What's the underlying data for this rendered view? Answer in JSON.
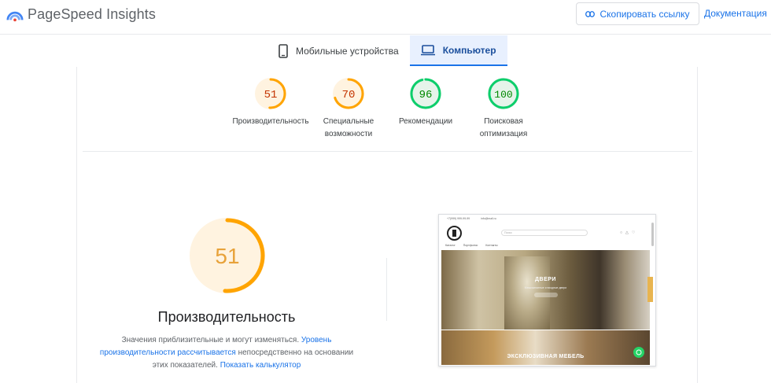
{
  "header": {
    "logo_text": "PageSpeed Insights",
    "copy_link_label": "Скопировать ссылку",
    "docs_label": "Документация"
  },
  "tabs": [
    {
      "label": "Мобильные устройства",
      "active": false,
      "icon": "phone-icon"
    },
    {
      "label": "Компьютер",
      "active": true,
      "icon": "laptop-icon"
    }
  ],
  "scores": [
    {
      "value": 51,
      "label_line1": "Производительность",
      "label_line2": "",
      "status": "average"
    },
    {
      "value": 70,
      "label_line1": "Специальные",
      "label_line2": "возможности",
      "status": "average"
    },
    {
      "value": 96,
      "label_line1": "Рекомендации",
      "label_line2": "",
      "status": "good"
    },
    {
      "value": 100,
      "label_line1": "Поисковая",
      "label_line2": "оптимизация",
      "status": "good"
    }
  ],
  "main_score": {
    "value": 51,
    "title": "Производительность",
    "note_prefix": "Значения приблизительные и могут изменяться. ",
    "note_link1": "Уровень производительности рассчитывается",
    "note_middle": " непосредственно на основании этих показателей. ",
    "note_link2": "Показать калькулятор"
  },
  "thumbnail": {
    "phone_text": "+7(999) 999-99-99",
    "email_text": "info@mail.ru",
    "search_placeholder": "Поиск",
    "nav": [
      "Каталог",
      "Портфолио",
      "Контакты"
    ],
    "hero_title": "ДВЕРИ",
    "hero_subtitle": "Межкомнатные и входные двери",
    "lower_title": "ЭКСКЛЮЗИВНАЯ МЕБЕЛЬ"
  },
  "colors": {
    "average": "#ffa400",
    "average_bg": "#fff3e0",
    "average_text": "#c33300",
    "good": "#0cce6b",
    "good_bg": "#e6f4ea",
    "good_text": "#008800",
    "accent": "#1a73e8"
  }
}
